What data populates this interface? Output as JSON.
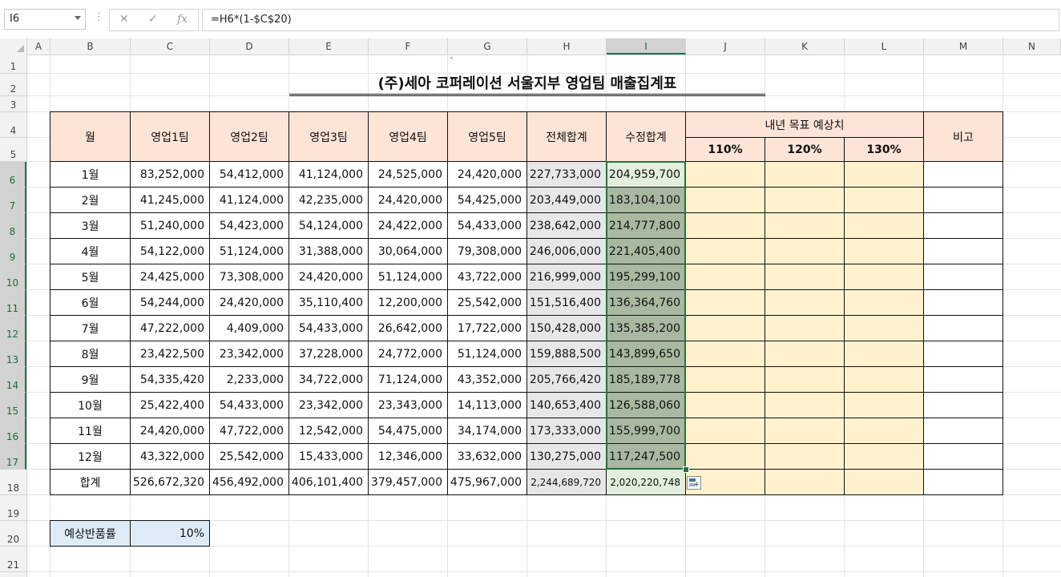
{
  "formula_bar": {
    "name_box": "I6",
    "more_options": "⋮",
    "cancel_glyph": "✕",
    "enter_glyph": "✓",
    "fx_glyph": "fx",
    "formula": "=H6*(1-$C$20)"
  },
  "columns": [
    "A",
    "B",
    "C",
    "D",
    "E",
    "F",
    "G",
    "H",
    "I",
    "J",
    "K",
    "L",
    "M",
    "N"
  ],
  "rows": [
    "1",
    "2",
    "3",
    "4",
    "5",
    "6",
    "7",
    "8",
    "9",
    "10",
    "11",
    "12",
    "13",
    "14",
    "15",
    "16",
    "17",
    "18",
    "19",
    "20",
    "21"
  ],
  "selected_cell": "I6",
  "sheet": {
    "stray_mark": "`",
    "title": "(주)세아 코퍼레이션 서울지부 영업팀 매출집계표",
    "headers": {
      "month": "월",
      "team1": "영업1팀",
      "team2": "영업2팀",
      "team3": "영업3팀",
      "team4": "영업4팀",
      "team5": "영업5팀",
      "total": "전체합계",
      "revised": "수정합계",
      "target_group": "내년 목표 예상치",
      "t110": "110%",
      "t120": "120%",
      "t130": "130%",
      "note": "비고"
    },
    "data_rows": [
      {
        "month": "1월",
        "v": [
          "83,252,000",
          "54,412,000",
          "41,124,000",
          "24,525,000",
          "24,420,000",
          "227,733,000",
          "204,959,700"
        ]
      },
      {
        "month": "2월",
        "v": [
          "41,245,000",
          "41,124,000",
          "42,235,000",
          "24,420,000",
          "54,425,000",
          "203,449,000",
          "183,104,100"
        ]
      },
      {
        "month": "3월",
        "v": [
          "51,240,000",
          "54,423,000",
          "54,124,000",
          "24,422,000",
          "54,433,000",
          "238,642,000",
          "214,777,800"
        ]
      },
      {
        "month": "4월",
        "v": [
          "54,122,000",
          "51,124,000",
          "31,388,000",
          "30,064,000",
          "79,308,000",
          "246,006,000",
          "221,405,400"
        ]
      },
      {
        "month": "5월",
        "v": [
          "24,425,000",
          "73,308,000",
          "24,420,000",
          "51,124,000",
          "43,722,000",
          "216,999,000",
          "195,299,100"
        ]
      },
      {
        "month": "6월",
        "v": [
          "54,244,000",
          "24,420,000",
          "35,110,400",
          "12,200,000",
          "25,542,000",
          "151,516,400",
          "136,364,760"
        ]
      },
      {
        "month": "7월",
        "v": [
          "47,222,000",
          "4,409,000",
          "54,433,000",
          "26,642,000",
          "17,722,000",
          "150,428,000",
          "135,385,200"
        ]
      },
      {
        "month": "8월",
        "v": [
          "23,422,500",
          "23,342,000",
          "37,228,000",
          "24,772,000",
          "51,124,000",
          "159,888,500",
          "143,899,650"
        ]
      },
      {
        "month": "9월",
        "v": [
          "54,335,420",
          "2,233,000",
          "34,722,000",
          "71,124,000",
          "43,352,000",
          "205,766,420",
          "185,189,778"
        ]
      },
      {
        "month": "10월",
        "v": [
          "25,422,400",
          "54,433,000",
          "23,342,000",
          "23,343,000",
          "14,113,000",
          "140,653,400",
          "126,588,060"
        ]
      },
      {
        "month": "11월",
        "v": [
          "24,420,000",
          "47,722,000",
          "12,542,000",
          "54,475,000",
          "34,174,000",
          "173,333,000",
          "155,999,700"
        ]
      },
      {
        "month": "12월",
        "v": [
          "43,322,000",
          "25,542,000",
          "15,433,000",
          "12,346,000",
          "33,632,000",
          "130,275,000",
          "117,247,500"
        ]
      }
    ],
    "total_row": {
      "label": "합계",
      "v": [
        "526,672,320",
        "456,492,000",
        "406,101,400",
        "379,457,000",
        "475,967,000",
        "2,244,689,720",
        "2,020,220,748"
      ]
    },
    "return_rate": {
      "label": "예상반품률",
      "value": "10%"
    }
  },
  "colors": {
    "header_fill": "#fce4d6",
    "total_fill": "#e7e7e7",
    "revised_fill": "#a9b8a0",
    "target_fill": "#fff2cc",
    "rate_label_fill": "#ddebf7",
    "selection": "#217346"
  }
}
